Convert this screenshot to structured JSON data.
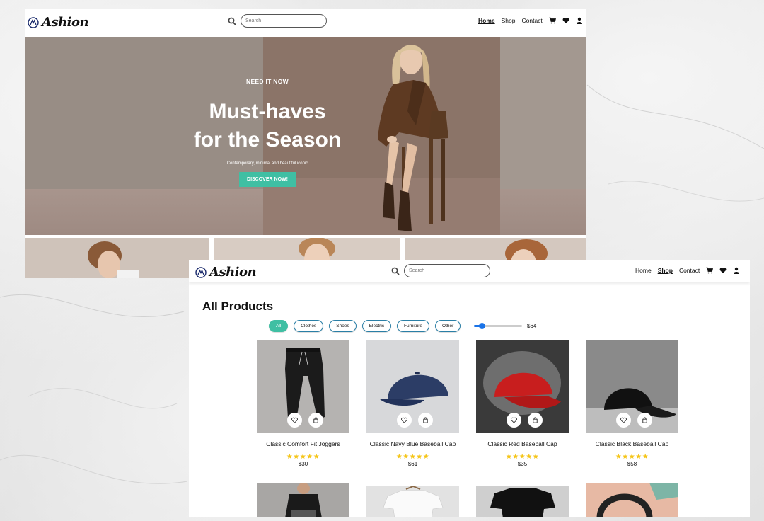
{
  "brand": {
    "name": "Ashion"
  },
  "search": {
    "placeholder": "Search"
  },
  "nav": {
    "items": [
      {
        "label": "Home"
      },
      {
        "label": "Shop"
      },
      {
        "label": "Contact"
      }
    ]
  },
  "hero": {
    "kicker": "NEED IT NOW",
    "title_line1": "Must-haves",
    "title_line2": "for the Season",
    "subtitle": "Contemporary, minimal and beautiful iconic",
    "cta": "DISCOVER NOW!"
  },
  "shop": {
    "title": "All Products",
    "filters": [
      "All",
      "Clothes",
      "Shoes",
      "Electric",
      "Furniture",
      "Other"
    ],
    "active_filter": "All",
    "price_max_label": "$64",
    "price_slider_fraction": 0.12,
    "products": [
      {
        "name": "Classic Comfort Fit Joggers",
        "stars": "★★★★★",
        "price": "$30"
      },
      {
        "name": "Classic Navy Blue Baseball Cap",
        "stars": "★★★★★",
        "price": "$61"
      },
      {
        "name": "Classic Red Baseball Cap",
        "stars": "★★★★★",
        "price": "$35"
      },
      {
        "name": "Classic Black Baseball Cap",
        "stars": "★★★★★",
        "price": "$58"
      }
    ]
  },
  "colors": {
    "accent": "#3fbfa3",
    "star": "#f5c518",
    "slider": "#1a73e8"
  }
}
